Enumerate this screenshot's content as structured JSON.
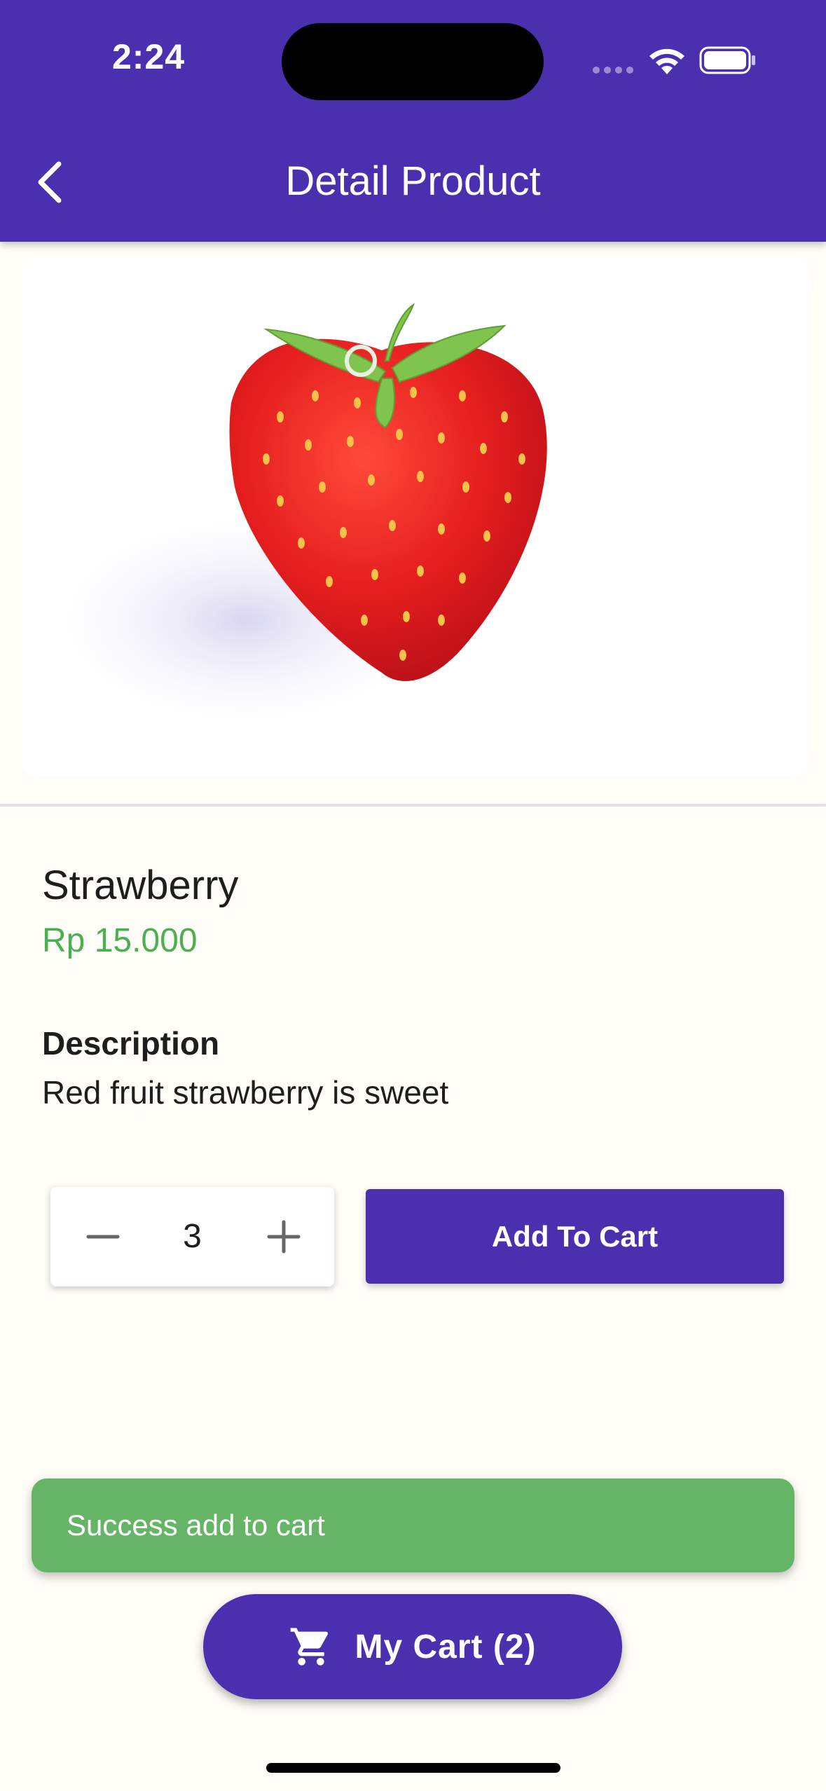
{
  "status_bar": {
    "time": "2:24"
  },
  "appbar": {
    "title": "Detail Product",
    "back_icon": "chevron-left-icon"
  },
  "product": {
    "name": "Strawberry",
    "price": "Rp 15.000",
    "image_subject": "strawberry"
  },
  "description": {
    "heading": "Description",
    "text": "Red fruit strawberry is sweet"
  },
  "quantity": {
    "value": "3",
    "minus_icon": "minus-icon",
    "plus_icon": "plus-icon"
  },
  "add_to_cart": {
    "label": "Add To Cart"
  },
  "snackbar": {
    "message": "Success add to cart"
  },
  "cart_button": {
    "label": "My Cart (2)",
    "icon": "shopping-cart-icon"
  },
  "colors": {
    "primary": "#4a2fae",
    "price_green": "#4caf50",
    "snackbar_green": "#66b566",
    "background": "#fffdf8"
  }
}
